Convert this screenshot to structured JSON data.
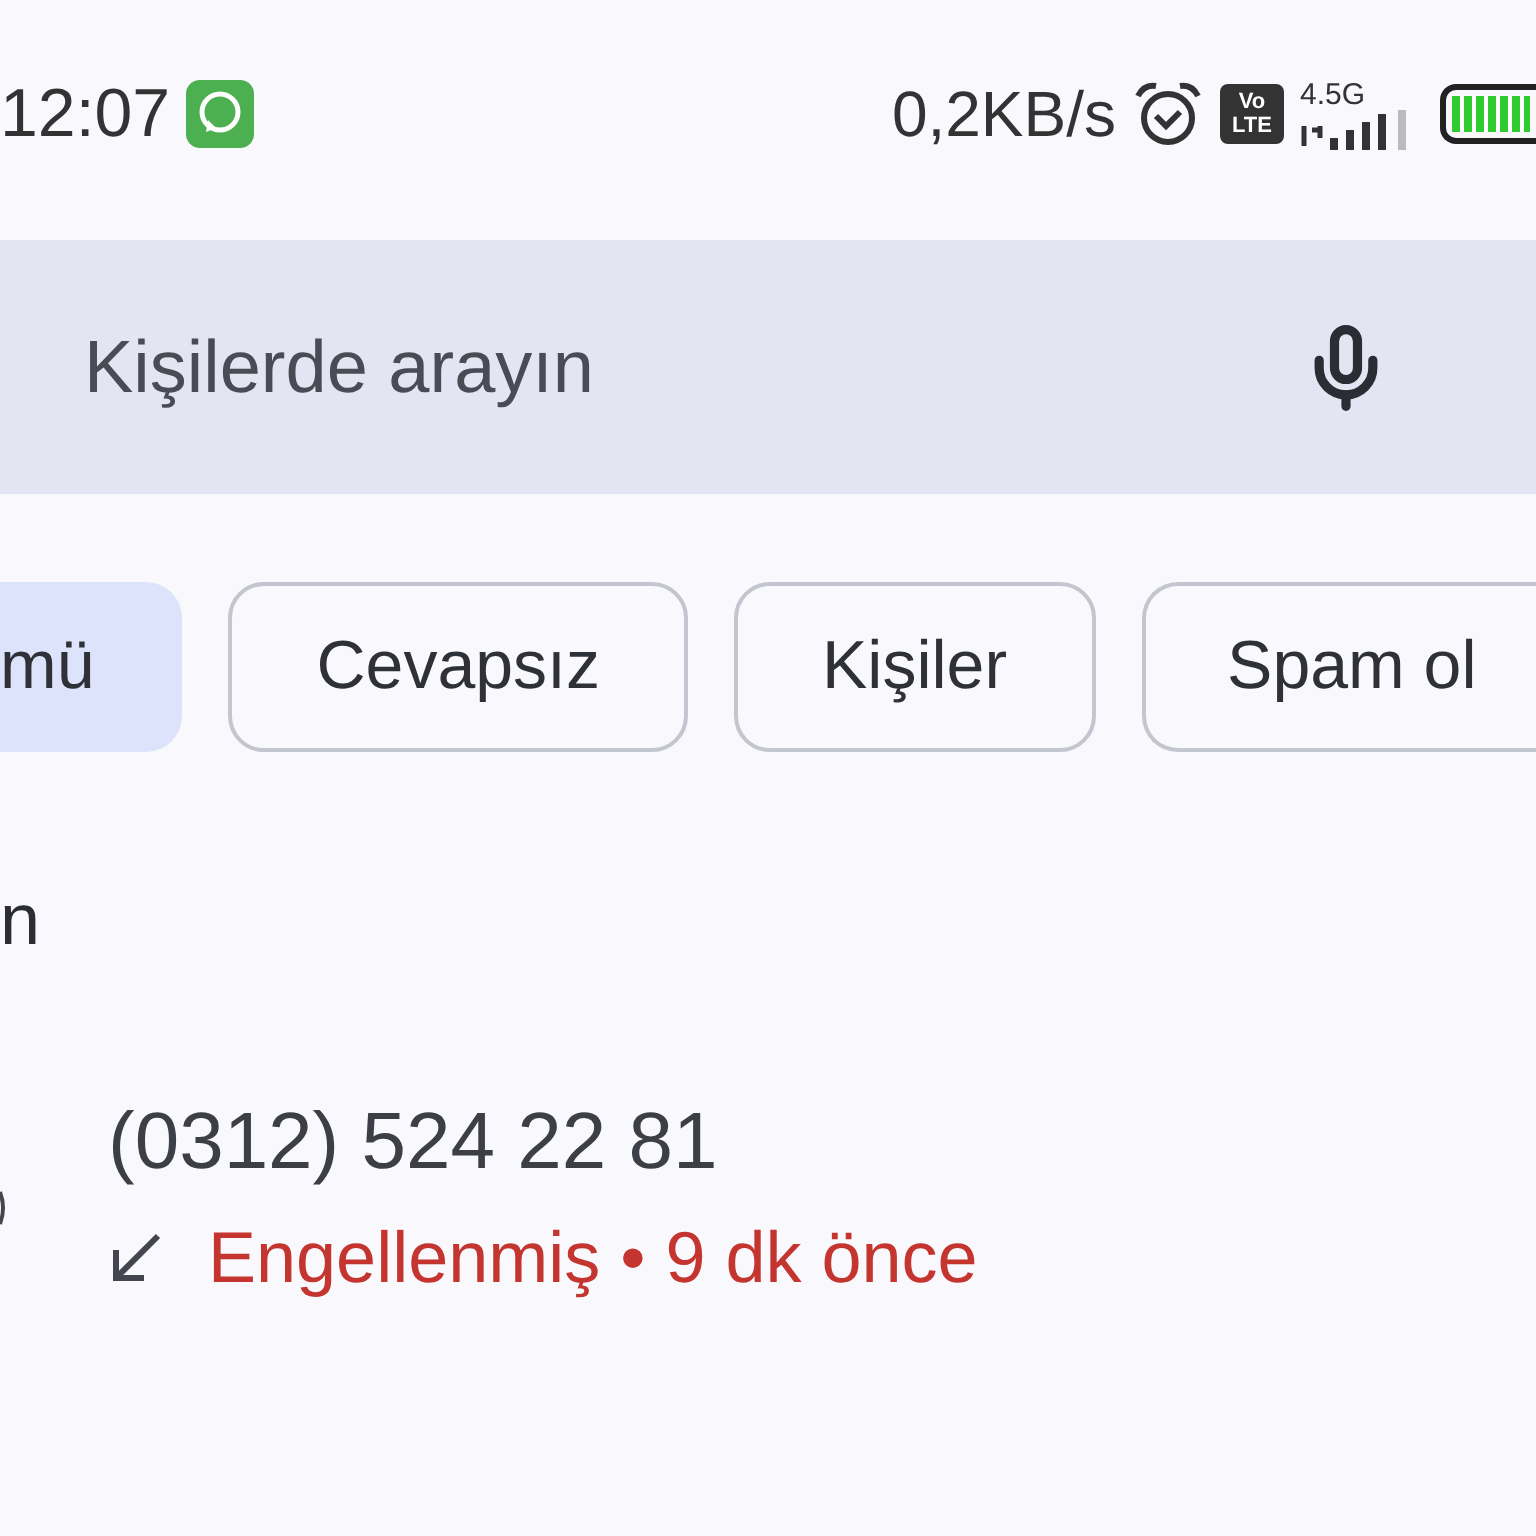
{
  "status_bar": {
    "time": "12:07",
    "speed": "0,2KB/s",
    "volte": [
      "Vo",
      "LTE"
    ],
    "network": "4.5G"
  },
  "search": {
    "placeholder": "Kişilerde arayın"
  },
  "filters": [
    {
      "label": "mü",
      "selected": true
    },
    {
      "label": "Cevapsız",
      "selected": false
    },
    {
      "label": "Kişiler",
      "selected": false
    },
    {
      "label": "Spam ol",
      "selected": false
    }
  ],
  "section_heading": "n",
  "calls": [
    {
      "number": "(0312) 524 22 81",
      "status": "Engellenmiş • 9 dk önce",
      "blocked": true
    }
  ]
}
